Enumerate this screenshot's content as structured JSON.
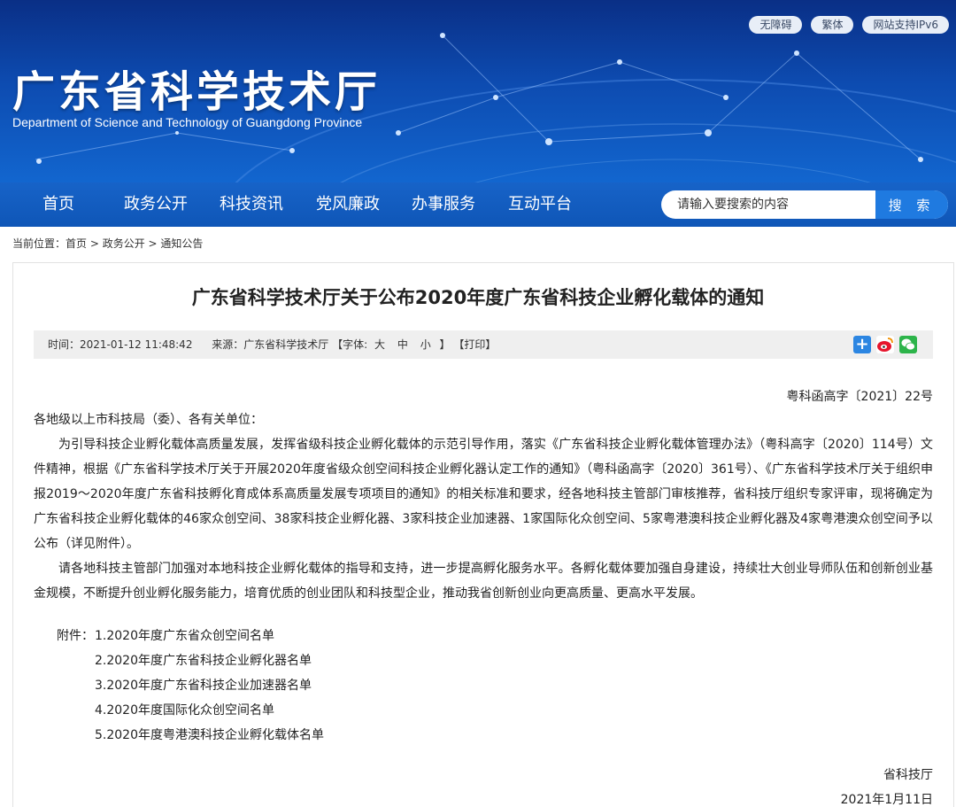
{
  "header": {
    "top_links": [
      "无障碍",
      "繁体",
      "网站支持IPv6"
    ],
    "title": "广东省科学技术厅",
    "subtitle": "Department of Science and Technology of Guangdong Province"
  },
  "nav": {
    "items": [
      "首页",
      "政务公开",
      "科技资讯",
      "党风廉政",
      "办事服务",
      "互动平台"
    ],
    "search_placeholder": "请输入要搜索的内容",
    "search_button": "搜 索"
  },
  "breadcrumb": {
    "prefix": "当前位置：",
    "items": [
      "首页",
      "政务公开",
      "通知公告"
    ],
    "separator": " > "
  },
  "article": {
    "title": "广东省科学技术厅关于公布2020年度广东省科技企业孵化载体的通知",
    "meta": {
      "time": "时间：2021-01-12 11:48:42",
      "source": "来源：广东省科学技术厅",
      "font_label": "【字体:",
      "font_large": "大",
      "font_medium": "中",
      "font_small": "小",
      "font_close": "】",
      "print": "【打印】"
    },
    "share_icons": [
      "plus-share-icon",
      "weibo-icon",
      "wechat-icon"
    ],
    "doc_number": "粤科函高字〔2021〕22号",
    "salutation": "各地级以上市科技局（委）、各有关单位：",
    "paragraph_1": "为引导科技企业孵化载体高质量发展，发挥省级科技企业孵化载体的示范引导作用，落实《广东省科技企业孵化载体管理办法》（粤科高字〔2020〕114号）文件精神，根据《广东省科学技术厅关于开展2020年度省级众创空间科技企业孵化器认定工作的通知》（粤科函高字〔2020〕361号）、《广东省科学技术厅关于组织申报2019～2020年度广东省科技孵化育成体系高质量发展专项项目的通知》的相关标准和要求，经各地科技主管部门审核推荐，省科技厅组织专家评审，现将确定为广东省科技企业孵化载体的46家众创空间、38家科技企业孵化器、3家科技企业加速器、1家国际化众创空间、5家粤港澳科技企业孵化器及4家粤港澳众创空间予以公布（详见附件）。",
    "paragraph_2": "请各地科技主管部门加强对本地科技企业孵化载体的指导和支持，进一步提高孵化服务水平。各孵化载体要加强自身建设，持续壮大创业导师队伍和创新创业基金规模，不断提升创业孵化服务能力，培育优质的创业团队和科技型企业，推动我省创新创业向更高质量、更高水平发展。",
    "attachments_label": "附件：",
    "attachments": [
      "1.2020年度广东省众创空间名单",
      "2.2020年度广东省科技企业孵化器名单",
      "3.2020年度广东省科技企业加速器名单",
      "4.2020年度国际化众创空间名单",
      "5.2020年度粤港澳科技企业孵化载体名单"
    ],
    "signature": "省科技厅",
    "date": "2021年1月11日"
  },
  "colors": {
    "banner_dark": "#0a2f86",
    "banner_light": "#1266cf",
    "nav": "#1763c8",
    "search_button": "#1f7ae0",
    "meta_bar": "#efefef"
  }
}
